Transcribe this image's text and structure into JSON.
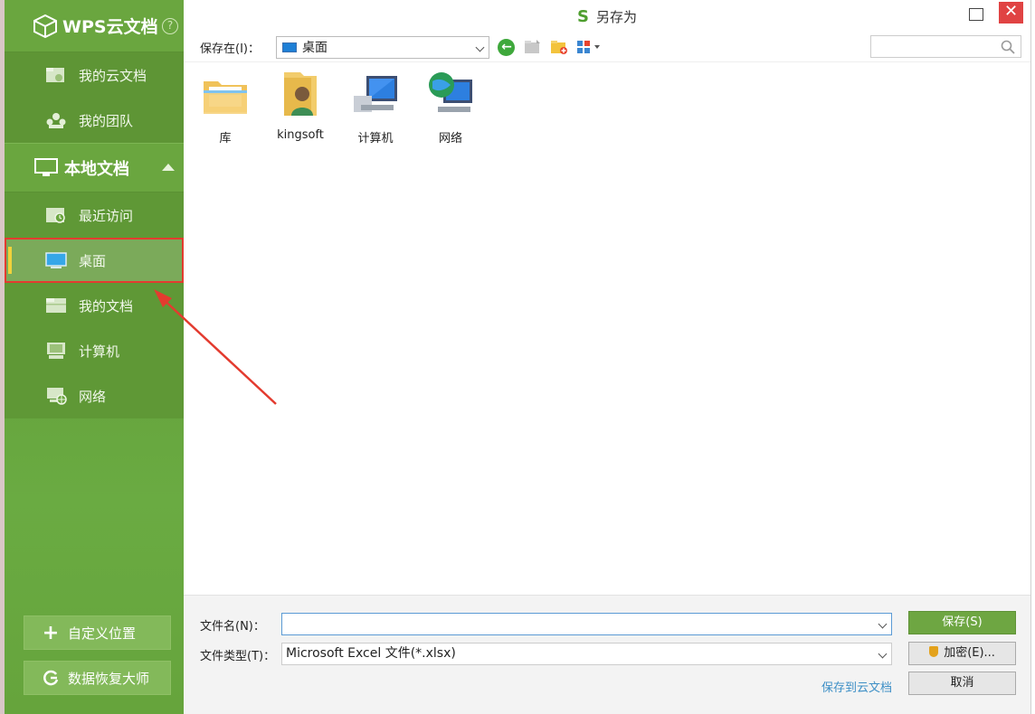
{
  "sidebar": {
    "app_title": "WPS云文档",
    "help_glyph": "?",
    "cloud_items": [
      {
        "label": "我的云文档",
        "icon": "cloud-folder-icon"
      },
      {
        "label": "我的团队",
        "icon": "team-icon"
      }
    ],
    "local_section": {
      "label": "本地文档",
      "icon": "monitor-icon"
    },
    "local_items": [
      {
        "label": "最近访问",
        "icon": "recent-folder-icon"
      },
      {
        "label": "桌面",
        "icon": "desktop-icon",
        "selected": true
      },
      {
        "label": "我的文档",
        "icon": "documents-folder-icon"
      },
      {
        "label": "计算机",
        "icon": "computer-icon"
      },
      {
        "label": "网络",
        "icon": "network-icon"
      }
    ],
    "bottom_buttons": [
      {
        "label": "自定义位置",
        "icon": "plus-icon"
      },
      {
        "label": "数据恢复大师",
        "icon": "recovery-icon"
      }
    ]
  },
  "dialog": {
    "title": "另存为",
    "toolbar": {
      "save_in_label": "保存在(I)：",
      "location_value": "桌面",
      "search_placeholder": ""
    },
    "files": [
      {
        "name": "库",
        "icon": "library-folder-icon"
      },
      {
        "name": "kingsoft",
        "icon": "user-folder-icon"
      },
      {
        "name": "计算机",
        "icon": "computer-icon"
      },
      {
        "name": "网络",
        "icon": "network-globe-icon"
      }
    ],
    "filename_label": "文件名(N)：",
    "filename_value": "",
    "filetype_label": "文件类型(T)：",
    "filetype_value": "Microsoft Excel 文件(*.xlsx)",
    "buttons": {
      "save": "保存(S)",
      "encrypt": "加密(E)...",
      "cancel": "取消"
    },
    "cloud_link": "保存到云文档"
  },
  "colors": {
    "sidebar_green": "#64a13b",
    "primary_button": "#6ea642",
    "highlight_red": "#e33b2f",
    "close_red": "#e04343",
    "link_blue": "#3d8fc6"
  }
}
